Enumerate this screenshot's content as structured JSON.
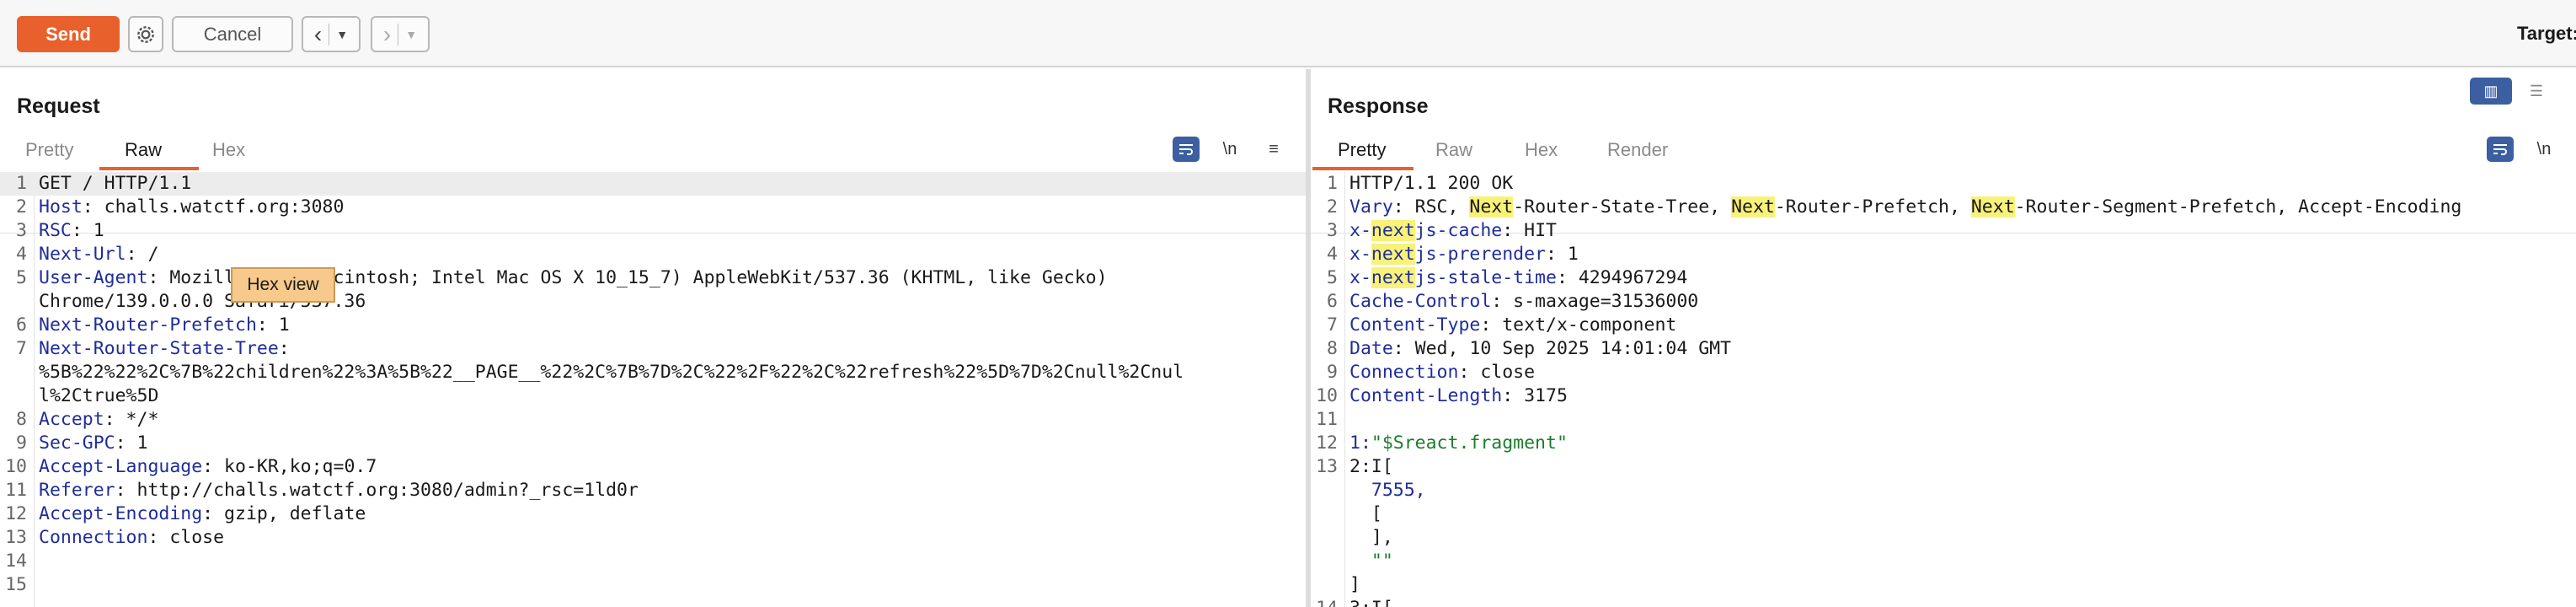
{
  "toolbar": {
    "send_label": "Send",
    "cancel_label": "Cancel",
    "target_label": "Target:"
  },
  "request": {
    "title": "Request",
    "tabs": [
      "Pretty",
      "Raw",
      "Hex"
    ],
    "active_tab": "Raw",
    "lines": [
      {
        "n": "1",
        "name": "",
        "value": "GET / HTTP/1.1"
      },
      {
        "n": "2",
        "name": "Host",
        "value": "challs.watctf.org:3080"
      },
      {
        "n": "3",
        "name": "RSC",
        "value": "1"
      },
      {
        "n": "4",
        "name": "Next-Url",
        "value": "/"
      },
      {
        "n": "5",
        "name": "User-Agent",
        "value": "Mozilla/5.0 (Macintosh; Intel Mac OS X 10_15_7) AppleWebKit/537.36 (KHTML, like Gecko)",
        "cont": [
          "Chrome/139.0.0.0 Safari/537.36"
        ]
      },
      {
        "n": "6",
        "name": "Next-Router-Prefetch",
        "value": "1"
      },
      {
        "n": "7",
        "name": "Next-Router-State-Tree",
        "value": "",
        "cont": [
          "%5B%22%22%2C%7B%22children%22%3A%5B%22__PAGE__%22%2C%7B%7D%2C%22%2F%22%2C%22refresh%22%5D%7D%2Cnull%2Cnul",
          "l%2Ctrue%5D"
        ]
      },
      {
        "n": "8",
        "name": "Accept",
        "value": "*/*"
      },
      {
        "n": "9",
        "name": "Sec-GPC",
        "value": "1"
      },
      {
        "n": "10",
        "name": "Accept-Language",
        "value": "ko-KR,ko;q=0.7"
      },
      {
        "n": "11",
        "name": "Referer",
        "value": "http://challs.watctf.org:3080/admin?_rsc=1ld0r"
      },
      {
        "n": "12",
        "name": "Accept-Encoding",
        "value": "gzip, deflate"
      },
      {
        "n": "13",
        "name": "Connection",
        "value": "close"
      },
      {
        "n": "14",
        "name": "",
        "value": ""
      },
      {
        "n": "15",
        "name": "",
        "value": ""
      }
    ],
    "tooltip": "Hex view",
    "wrap_icon": "wrap-icon",
    "newline_label": "\\n",
    "menu_icon": "menu-icon"
  },
  "response": {
    "title": "Response",
    "tabs": [
      "Pretty",
      "Raw",
      "Hex",
      "Render"
    ],
    "active_tab": "Pretty",
    "status_line": "HTTP/1.1 200 OK",
    "vary_name": "Vary",
    "vary_parts": [
      "RSC, ",
      "Next",
      "-Router-State-Tree, ",
      "Next",
      "-Router-Prefetch, ",
      "Next",
      "-Router-Segment-Prefetch, Accept-Encoding"
    ],
    "x_lines": [
      {
        "n": "3",
        "pre": "x-",
        "hl": "next",
        "post": "js-cache",
        "value": "HIT"
      },
      {
        "n": "4",
        "pre": "x-",
        "hl": "next",
        "post": "js-prerender",
        "value": "1"
      },
      {
        "n": "5",
        "pre": "x-",
        "hl": "next",
        "post": "js-stale-time",
        "value": "4294967294"
      }
    ],
    "headers": [
      {
        "n": "6",
        "name": "Cache-Control",
        "value": "s-maxage=31536000"
      },
      {
        "n": "7",
        "name": "Content-Type",
        "value": "text/x-component"
      },
      {
        "n": "8",
        "name": "Date",
        "value": "Wed, 10 Sep 2025 14:01:04 GMT"
      },
      {
        "n": "9",
        "name": "Connection",
        "value": "close"
      },
      {
        "n": "10",
        "name": "Content-Length",
        "value": "3175"
      }
    ],
    "body": {
      "l11": "11",
      "l12": "12",
      "l12_key": "1:",
      "l12_str": "\"$Sreact.fragment\"",
      "l13": "13",
      "l13_text": "2:I[",
      "num": "7555,",
      "open": "[",
      "close_bracket": "],",
      "empty_str": "\"\"",
      "end": "]",
      "l14_partial": "3:I["
    },
    "newline_label": "\\n"
  },
  "colors": {
    "accent": "#e8612c",
    "header_name": "#1f2d9a",
    "highlight": "#f9f27a",
    "string": "#1b7d2a"
  }
}
